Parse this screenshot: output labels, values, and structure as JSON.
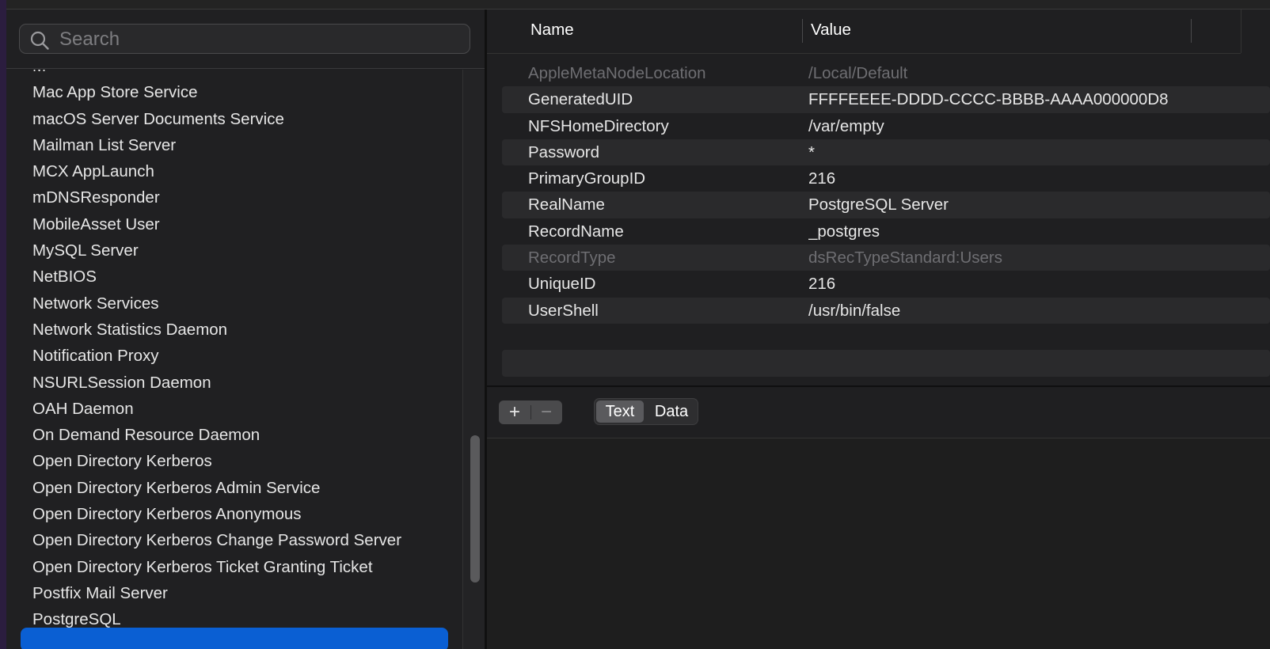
{
  "search": {
    "placeholder": "Search"
  },
  "sidebar": {
    "items": [
      "Mac App Store Service",
      "macOS Server Documents Service",
      "Mailman List Server",
      "MCX AppLaunch",
      "mDNSResponder",
      "MobileAsset User",
      "MySQL Server",
      "NetBIOS",
      "Network Services",
      "Network Statistics Daemon",
      "Notification Proxy",
      "NSURLSession Daemon",
      "OAH Daemon",
      "On Demand Resource Daemon",
      "Open Directory Kerberos",
      "Open Directory Kerberos Admin Service",
      "Open Directory Kerberos Anonymous",
      "Open Directory Kerberos Change Password Server",
      "Open Directory Kerberos Ticket Granting Ticket",
      "Postfix Mail Server",
      "PostgreSQL"
    ]
  },
  "table": {
    "headers": {
      "name": "Name",
      "value": "Value"
    },
    "rows": [
      {
        "name": "AppleMetaNodeLocation",
        "value": "/Local/Default",
        "dim": true
      },
      {
        "name": "GeneratedUID",
        "value": "FFFFEEEE-DDDD-CCCC-BBBB-AAAA000000D8",
        "dim": false
      },
      {
        "name": "NFSHomeDirectory",
        "value": "/var/empty",
        "dim": false
      },
      {
        "name": "Password",
        "value": "*",
        "dim": false
      },
      {
        "name": "PrimaryGroupID",
        "value": "216",
        "dim": false
      },
      {
        "name": "RealName",
        "value": "PostgreSQL Server",
        "dim": false
      },
      {
        "name": "RecordName",
        "value": "_postgres",
        "dim": false
      },
      {
        "name": "RecordType",
        "value": "dsRecTypeStandard:Users",
        "dim": true
      },
      {
        "name": "UniqueID",
        "value": "216",
        "dim": false
      },
      {
        "name": "UserShell",
        "value": "/usr/bin/false",
        "dim": false
      }
    ]
  },
  "toolbar": {
    "plus_label": "+",
    "minus_label": "−",
    "format_options": [
      "Text",
      "Data"
    ],
    "selected_format": "Text"
  },
  "colors": {
    "selection": "#0a5fd3",
    "background": "#1e1e1e",
    "row_alt": "#2a2a2c",
    "dim_text": "#6e6e72"
  }
}
